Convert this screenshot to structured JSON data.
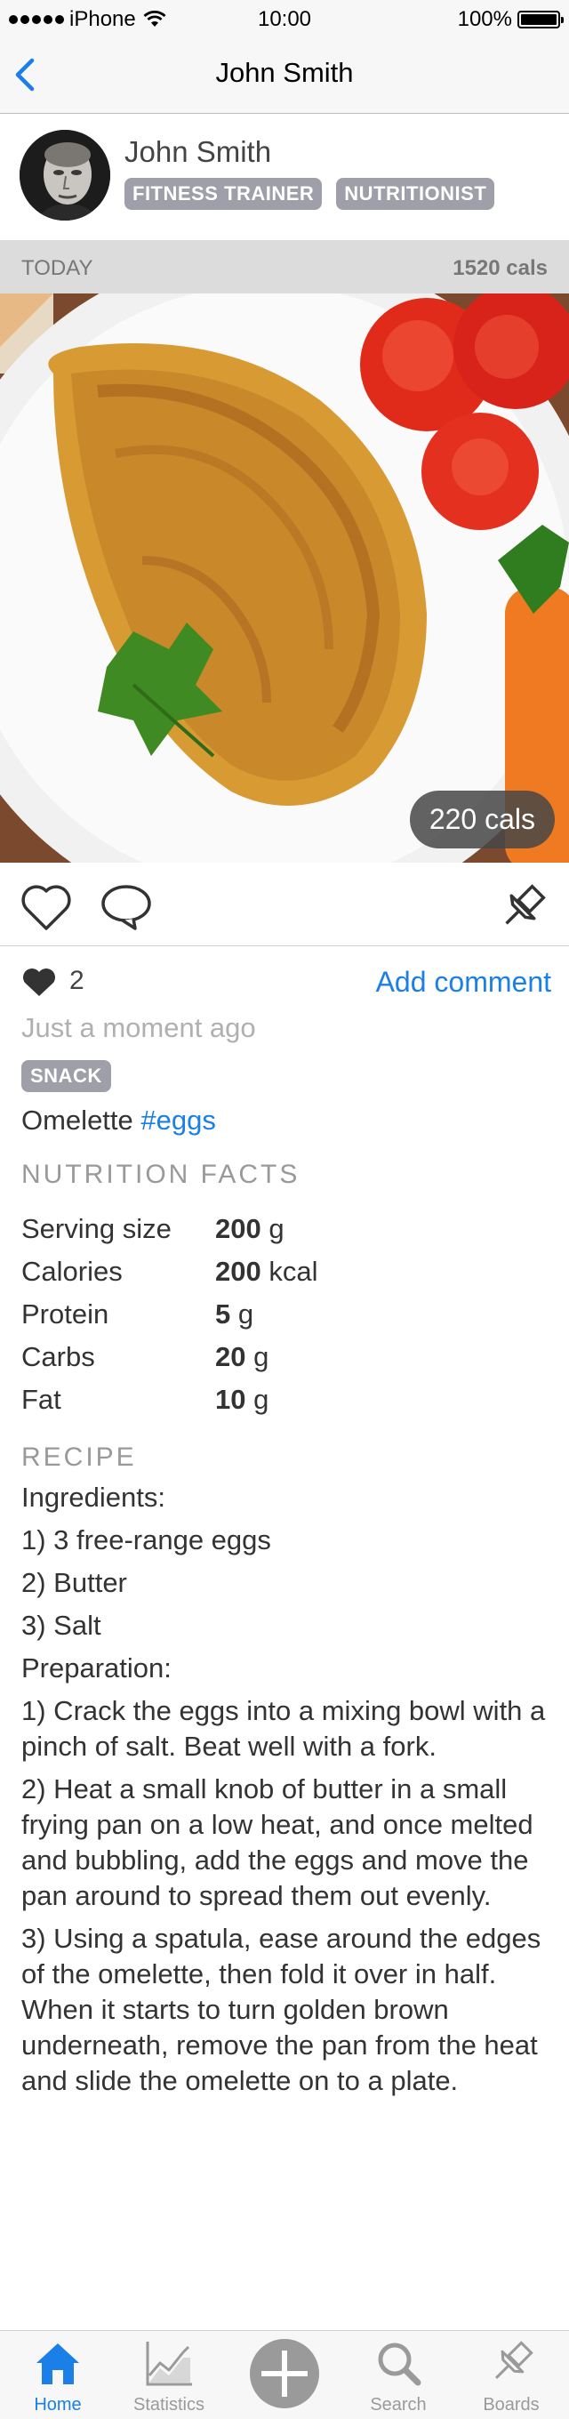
{
  "status_bar": {
    "carrier": "iPhone",
    "time": "10:00",
    "battery": "100%"
  },
  "nav": {
    "title": "John Smith",
    "back_icon": "chevron-left-icon"
  },
  "profile": {
    "name": "John Smith",
    "tags": [
      "FITNESS TRAINER",
      "NUTRITIONIST"
    ]
  },
  "day": {
    "label": "TODAY",
    "calories": "1520 cals"
  },
  "post": {
    "photo_calories": "220 cals",
    "likes": "2",
    "add_comment": "Add comment",
    "time": "Just a moment ago",
    "meal_type": "SNACK",
    "description": "Omelette",
    "hashtag": "#eggs"
  },
  "nutrition": {
    "heading": "NUTRITION FACTS",
    "rows": [
      {
        "label": "Serving size",
        "value": "200",
        "unit": "g"
      },
      {
        "label": "Calories",
        "value": "200",
        "unit": "kcal"
      },
      {
        "label": "Protein",
        "value": "5",
        "unit": "g"
      },
      {
        "label": "Carbs",
        "value": "20",
        "unit": "g"
      },
      {
        "label": "Fat",
        "value": "10",
        "unit": "g"
      }
    ]
  },
  "recipe": {
    "heading": "RECIPE",
    "lines": [
      "Ingredients:",
      "1) 3 free-range eggs",
      "2) Butter",
      "3) Salt",
      "Preparation:",
      "1) Crack the eggs into a mixing bowl with a pinch of salt. Beat well with a fork.",
      "2) Heat a small knob of butter in a small frying pan on a low heat, and once melted and bubbling, add the eggs and move the pan around to spread them out evenly.",
      "3) Using a spatula, ease around the edges of the omelette, then fold it over in half. When it starts to turn golden brown underneath, remove the pan from the heat and slide the omelette on to a plate."
    ]
  },
  "tabbar": {
    "home": "Home",
    "statistics": "Statistics",
    "search": "Search",
    "boards": "Boards"
  },
  "colors": {
    "accent": "#1a7fe6",
    "tag_bg": "#9e9fa8",
    "day_bar": "#dcdcdc"
  }
}
